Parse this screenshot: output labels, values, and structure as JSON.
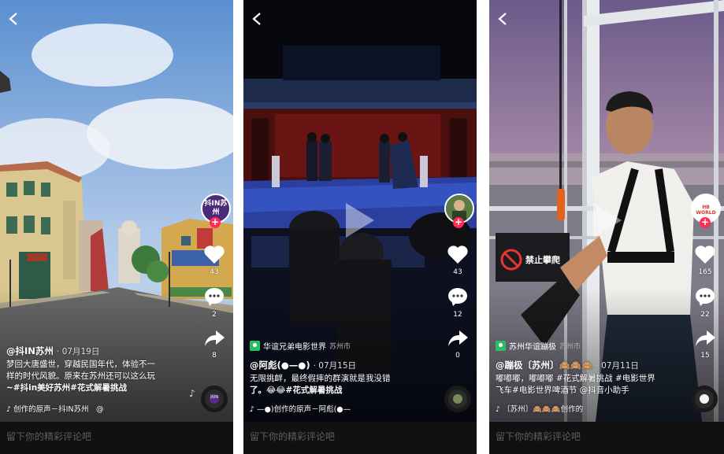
{
  "comment_placeholder": "留下你的精彩评论吧",
  "panels": [
    {
      "avatar_text": "抖IN苏州",
      "likes": "43",
      "comments": "2",
      "shares": "8",
      "author": "@抖IN苏州",
      "date": "· 07月19日",
      "caption_line1": "梦回大唐盛世，穿越民国年代，体验不一",
      "caption_line2": "样的时代风貌。原来在苏州还可以这么玩",
      "caption_line3": "~#抖in美好苏州#花式解暑挑战",
      "music": "♪ 创作的原声－抖IN苏州　@",
      "disc_text": "抖IN"
    },
    {
      "location": "华谊兄弟电影世界",
      "location_city": "苏州市",
      "likes": "43",
      "comments": "12",
      "shares": "0",
      "author": "@阿彪(●—●)",
      "date": "· 07月15日",
      "caption_line1": "无限挑衅，最终假摔的群演就是我没错",
      "caption_line2": "了。😂😂#花式解暑挑战",
      "music": "♪ —●)创作的原声－阿彪(●—"
    },
    {
      "location": "苏州华谊蹦极",
      "location_city": "苏州市",
      "likes": "165",
      "comments": "22",
      "shares": "15",
      "author": "@蹦极〔苏州〕🙈🙈🙈",
      "date": "· 07月11日",
      "caption_line1": "嘟嘟嘟，嘟嘟嘟 #花式解暑挑战 #电影世界",
      "caption_line2": "飞车#电影世界啤酒节 @抖音小助手",
      "music": "♪ 〔苏州〕🙈🙈🙈创作的",
      "sign_text": "禁止攀爬",
      "logo_text": "HB WORLD"
    }
  ],
  "colors": {
    "accent": "#ff2c55",
    "location_icon": "#27c161",
    "panel_bg": "#111111"
  }
}
